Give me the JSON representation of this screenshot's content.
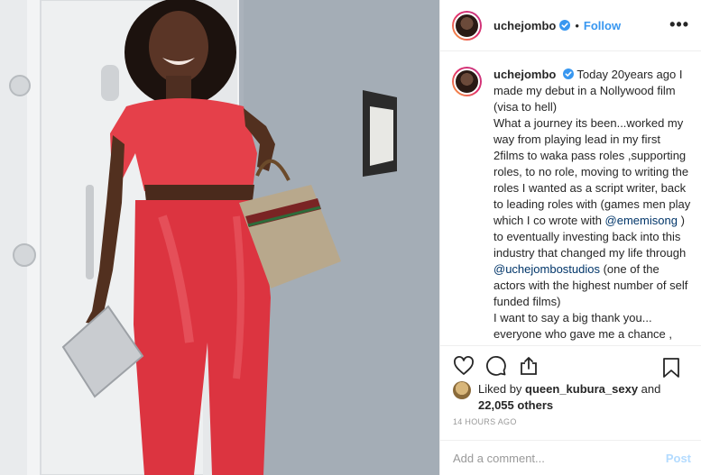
{
  "post": {
    "username": "uchejombo",
    "follow_label": "Follow",
    "separator": "•",
    "more_label": "•••"
  },
  "caption": {
    "username": "uchejombo",
    "text_1": "Today 20years ago I made my debut in a Nollywood film (visa to hell)",
    "text_2": "What a journey its been...worked my way from playing lead in my first 2films to waka pass roles ,supporting roles, to no role, moving to writing the roles I wanted as a script writer, back to leading roles with (games men play which I co wrote with ",
    "mention_1": "@ememisong",
    "text_3": " ) to eventually investing back into this industry that changed my life through ",
    "mention_2": "@uchejombostudios",
    "text_4": " (one of the actors with the highest number of self funded films)",
    "text_5": "I want to say a big thank you... everyone who gave me a chance , worked with me , partnered with me on projects and most importantly..."
  },
  "actions": {
    "icons": [
      "heart-icon",
      "comment-icon",
      "share-icon",
      "bookmark-icon"
    ]
  },
  "likes": {
    "prefix": "Liked by ",
    "user": "queen_kubura_sexy",
    "and": " and",
    "count": "22,055 others"
  },
  "timestamp": "14 HOURS AGO",
  "comment": {
    "placeholder": "Add a comment...",
    "post_label": "Post"
  },
  "colors": {
    "link": "#3897f0",
    "mention": "#003569",
    "verified": "#3897f0",
    "post_disabled": "#b3dbff"
  }
}
